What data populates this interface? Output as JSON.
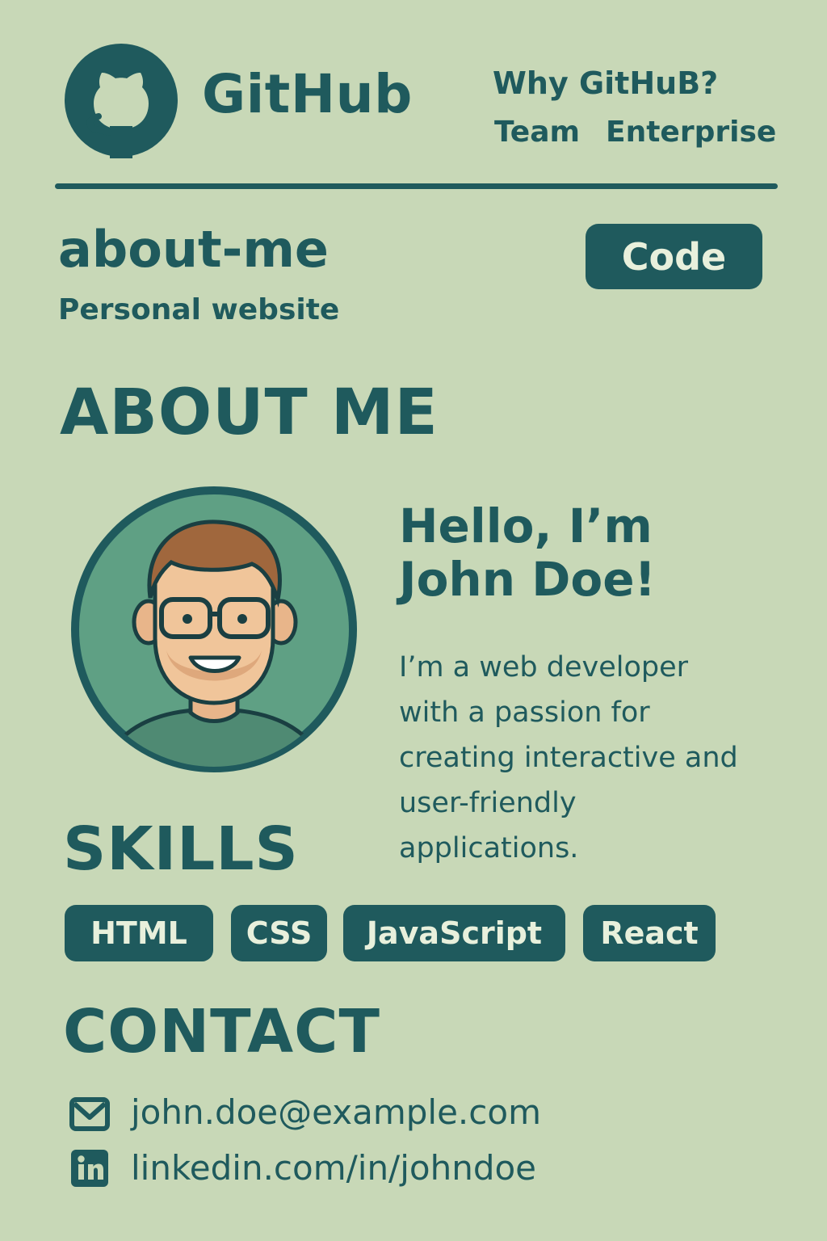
{
  "header": {
    "brand": "GitHub",
    "nav": [
      {
        "label": "Why GitHuB?"
      },
      {
        "label": "Team"
      },
      {
        "label": "Enterprise"
      }
    ]
  },
  "repo": {
    "name": "about-me",
    "description": "Personal website",
    "code_button": "Code"
  },
  "about": {
    "title": "ABOUT ME",
    "greeting_line1": "Hello, I’m",
    "greeting_line2": "John Doe!",
    "bio": "I’m a web developer with a passion for creating interactive and user-friendly applications."
  },
  "skills": {
    "title": "SKILLS",
    "items": [
      "HTML",
      "CSS",
      "JavaScript",
      "React"
    ]
  },
  "contact": {
    "title": "CONTACT",
    "email": "john.doe@example.com",
    "linkedin": "linkedin.com/in/johndoe"
  },
  "icons": {
    "logo": "github-octocat-icon",
    "email": "mail-icon",
    "linkedin": "linkedin-icon"
  },
  "colors": {
    "background": "#c8d8b7",
    "primary": "#1f5a5d",
    "chip_text": "#e8f0dc",
    "avatar_bg": "#5fa084"
  }
}
